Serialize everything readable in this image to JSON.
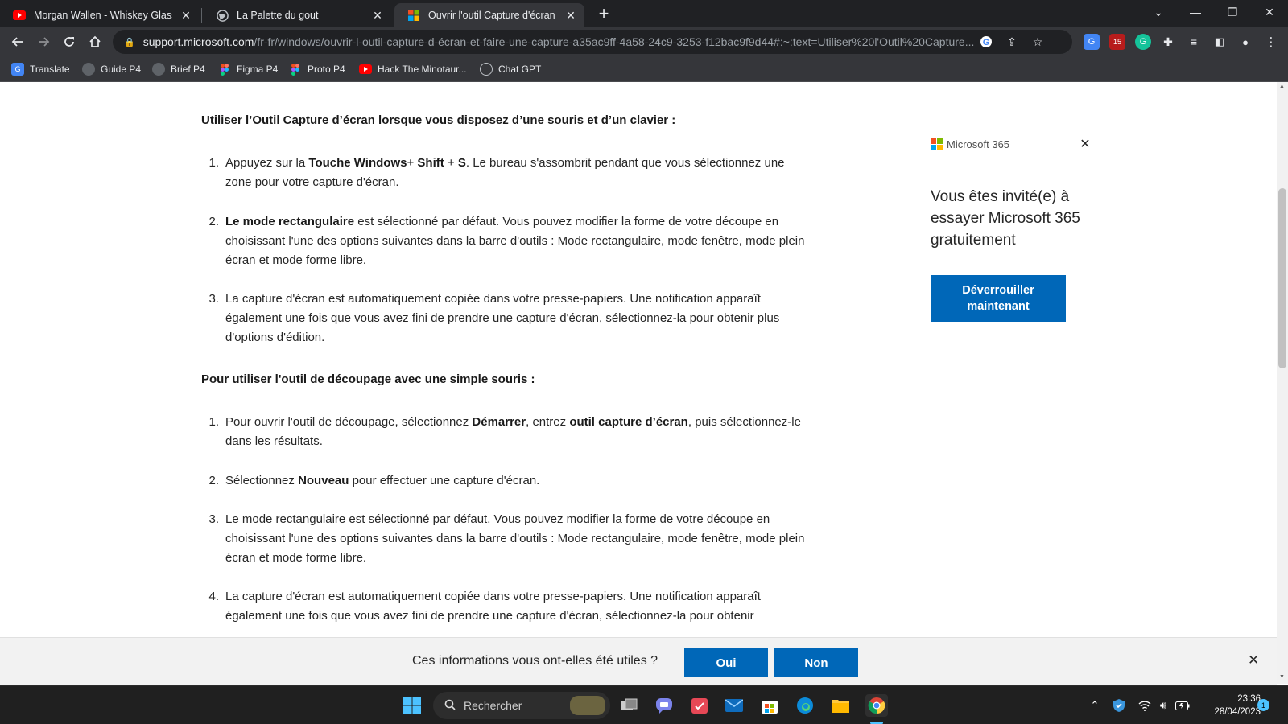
{
  "browser": {
    "tabs": [
      {
        "title": "Morgan Wallen - Whiskey Glasses",
        "icon": "youtube-icon"
      },
      {
        "title": "La Palette du gout",
        "icon": "globe-icon"
      },
      {
        "title": "Ouvrir l'outil Capture d'écran et f",
        "icon": "microsoft-icon"
      }
    ],
    "url_host": "support.microsoft.com",
    "url_path": "/fr-fr/windows/ouvrir-l-outil-capture-d-écran-et-faire-une-capture-a35ac9ff-4a58-24c9-3253-f12bac9f9d44#:~:text=Utiliser%20l'Outil%20Capture...",
    "ext_badge": "15",
    "bookmarks": [
      {
        "label": "Translate",
        "icon": "translate-icon"
      },
      {
        "label": "Guide P4",
        "icon": "globe-icon"
      },
      {
        "label": "Brief P4",
        "icon": "globe-icon"
      },
      {
        "label": "Figma P4",
        "icon": "figma-icon"
      },
      {
        "label": "Proto P4",
        "icon": "figma-icon"
      },
      {
        "label": "Hack The Minotaur...",
        "icon": "youtube-icon"
      },
      {
        "label": "Chat GPT",
        "icon": "chatgpt-icon"
      }
    ]
  },
  "article": {
    "section1_title": "Utiliser l’Outil Capture d’écran lorsque vous disposez d’une souris et d’un clavier :",
    "section1_items": [
      {
        "n": "1.",
        "b1": "Appuyez sur la ",
        "s1": "Touche Windows",
        "b2": "+ ",
        "s2": "Shift",
        "b3": " + ",
        "s3": "S",
        "b4": ". Le bureau s'assombrit pendant que vous sélectionnez une zone pour votre capture d'écran."
      },
      {
        "n": "2.",
        "s1": "Le mode rectangulaire",
        "b1": " est sélectionné par défaut. Vous pouvez modifier la forme de votre découpe en choisissant l'une des options suivantes dans la barre d'outils : Mode rectangulaire, mode fenêtre, mode plein écran et mode forme libre."
      },
      {
        "n": "3.",
        "b1": "La capture d'écran est automatiquement copiée dans votre presse-papiers. Une notification apparaît également une fois que vous avez fini de prendre une capture d'écran, sélectionnez-la pour obtenir plus d'options d'édition."
      }
    ],
    "section2_title": "Pour utiliser l'outil de découpage avec une simple souris :",
    "section2_items": [
      {
        "n": "1.",
        "b1": "Pour ouvrir l'outil de découpage, sélectionnez ",
        "s1": "Démarrer",
        "b2": ", entrez ",
        "s2": "outil capture d’écran",
        "b3": ", puis sélectionnez-le dans les résultats."
      },
      {
        "n": "2.",
        "b1": "Sélectionnez ",
        "s1": "Nouveau",
        "b2": " pour effectuer une capture d'écran."
      },
      {
        "n": "3.",
        "b1": "Le mode rectangulaire est sélectionné par défaut. Vous pouvez modifier la forme de votre découpe en choisissant l'une des options suivantes dans la barre d'outils : Mode rectangulaire, mode fenêtre, mode plein écran et mode forme libre."
      },
      {
        "n": "4.",
        "b1": "La capture d'écran est automatiquement copiée dans votre presse-papiers. Une notification apparaît également une fois que vous avez fini de prendre une capture d'écran, sélectionnez-la pour obtenir"
      }
    ]
  },
  "ad": {
    "brand": "Microsoft 365",
    "text": "Vous êtes invité(e) à essayer Microsoft 365 gratuitement",
    "button": "Déverrouiller maintenant"
  },
  "feedback": {
    "question": "Ces informations vous ont-elles été utiles ?",
    "yes": "Oui",
    "no": "Non"
  },
  "taskbar": {
    "search_placeholder": "Rechercher",
    "time": "23:36",
    "date": "28/04/2023",
    "notifications": "1"
  },
  "colors": {
    "accent": "#0067b8",
    "chrome_dark": "#202124",
    "chrome_mid": "#35363a"
  }
}
